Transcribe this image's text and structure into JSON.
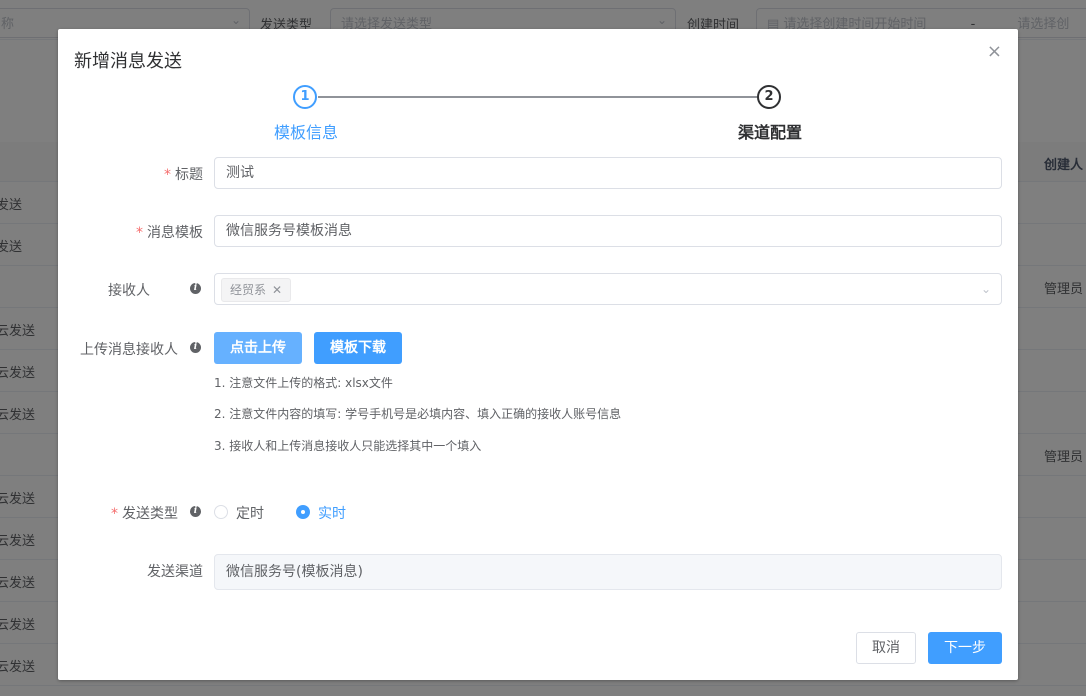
{
  "background": {
    "filters": {
      "name_placeholder": "称",
      "send_type_label": "发送类型",
      "send_type_placeholder": "请选择发送类型",
      "created_time_label": "创建时间",
      "start_placeholder": "请选择创建时间开始时间",
      "separator": "-",
      "end_placeholder": "请选择创"
    },
    "table": {
      "creator_header": "创建人",
      "rows": [
        {
          "col1": "发送",
          "creator": ""
        },
        {
          "col1": "发送",
          "creator": ""
        },
        {
          "col1": "",
          "creator": "管理员"
        },
        {
          "col1": "云发送",
          "creator": ""
        },
        {
          "col1": "云发送",
          "creator": ""
        },
        {
          "col1": "云发送",
          "creator": ""
        },
        {
          "col1": "",
          "creator": "管理员"
        },
        {
          "col1": "云发送",
          "creator": ""
        },
        {
          "col1": "云发送",
          "creator": ""
        },
        {
          "col1": "云发送",
          "creator": ""
        },
        {
          "col1": "云发送",
          "creator": ""
        },
        {
          "col1": "云发送",
          "creator": ""
        }
      ]
    }
  },
  "dialog": {
    "title": "新增消息发送",
    "close_glyph": "×",
    "steps": [
      {
        "number": "1",
        "title": "模板信息",
        "status": "active"
      },
      {
        "number": "2",
        "title": "渠道配置",
        "status": "pending"
      }
    ],
    "form": {
      "title_label": "标题",
      "title_value": "测试",
      "template_label": "消息模板",
      "template_value": "微信服务号模板消息",
      "recipient_label": "接收人",
      "recipient_tags": [
        {
          "label": "经贸系"
        }
      ],
      "upload_label": "上传消息接收人",
      "upload_button": "点击上传",
      "download_button": "模板下载",
      "notes": [
        "1. 注意文件上传的格式: xlsx文件",
        "2. 注意文件内容的填写: 学号手机号是必填内容、填入正确的接收人账号信息",
        "3. 接收人和上传消息接收人只能选择其中一个填入"
      ],
      "send_type_label": "发送类型",
      "send_type_options": [
        {
          "label": "定时",
          "checked": false
        },
        {
          "label": "实时",
          "checked": true
        }
      ],
      "channel_label": "发送渠道",
      "channel_value": "微信服务号(模板消息)",
      "required_mark": "*"
    },
    "footer": {
      "cancel": "取消",
      "next": "下一步"
    }
  },
  "colors": {
    "primary": "#409eff",
    "required": "#f56c6c",
    "overlay": "rgba(0,0,0,0.5)"
  }
}
